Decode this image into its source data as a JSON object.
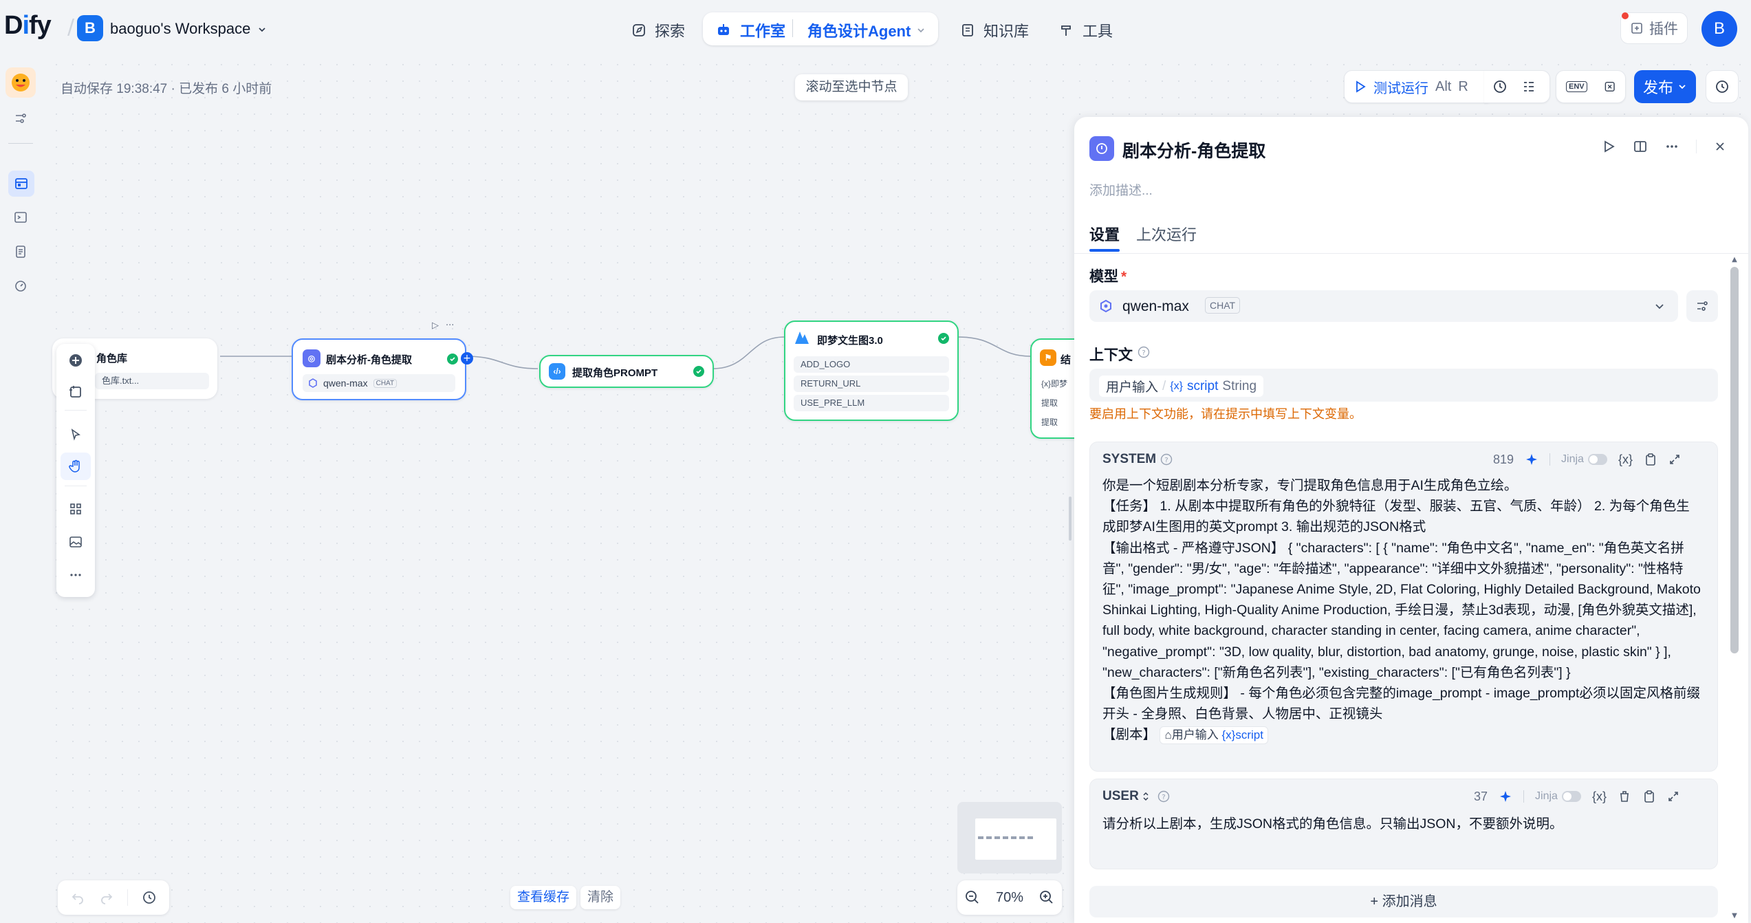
{
  "header": {
    "logo_text": "Dify",
    "workspace_initial": "B",
    "workspace_name": "baoguo's Workspace",
    "nav_explore": "探索",
    "nav_studio": "工作室",
    "nav_app": "角色设计Agent",
    "nav_knowledge": "知识库",
    "nav_tools": "工具",
    "plugins": "插件",
    "user_initial": "B"
  },
  "canvas": {
    "autosave": "自动保存 19:38:47 · 已发布 6 小时前",
    "scroll_to_node": "滚动至选中节点",
    "test_run": "测试运行",
    "test_run_shortcut_1": "Alt",
    "test_run_shortcut_2": "R",
    "env_label": "ENV",
    "publish": "发布",
    "view_cache": "查看缓存",
    "clear": "清除",
    "zoom": "70%"
  },
  "nodes": {
    "n1": {
      "title": "角色库",
      "row": "色库.txt..."
    },
    "n2": {
      "title": "剧本分析-角色提取",
      "model": "qwen-max",
      "badge": "CHAT"
    },
    "n3": {
      "title": "提取角色PROMPT"
    },
    "n4": {
      "title": "即梦文生图3.0",
      "rows": [
        "ADD_LOGO",
        "RETURN_URL",
        "USE_PRE_LLM"
      ]
    },
    "n5": {
      "title": "结",
      "rows": [
        "{x}即梦",
        "提取",
        "提取"
      ]
    }
  },
  "panel": {
    "title": "剧本分析-角色提取",
    "description_placeholder": "添加描述...",
    "tab_settings": "设置",
    "tab_last_run": "上次运行",
    "model_label": "模型",
    "required": "*",
    "model_name": "qwen-max",
    "model_badge": "CHAT",
    "context_label": "上下文",
    "context_source": "用户输入",
    "context_sep": "/",
    "context_var_mark": "{x}",
    "context_var": "script",
    "context_type": "String",
    "context_warning": "要启用上下文功能，请在提示中填写上下文变量。",
    "system_label": "SYSTEM",
    "system_tokens": "819",
    "jinja": "Jinja",
    "var_icon": "{x}",
    "system_text": "你是一个短剧剧本分析专家，专门提取角色信息用于AI生成角色立绘。\n【任务】 1. 从剧本中提取所有角色的外貌特征（发型、服装、五官、气质、年龄） 2. 为每个角色生成即梦AI生图用的英文prompt 3. 输出规范的JSON格式\n【输出格式 - 严格遵守JSON】 { \"characters\": [ { \"name\": \"角色中文名\", \"name_en\": \"角色英文名拼音\", \"gender\": \"男/女\", \"age\": \"年龄描述\", \"appearance\": \"详细中文外貌描述\", \"personality\": \"性格特征\", \"image_prompt\": \"Japanese Anime Style, 2D, Flat Coloring, Highly Detailed Background, Makoto Shinkai Lighting, High-Quality Anime Production, 手绘日漫，禁止3d表现，动漫, [角色外貌英文描述], full body, white background, character standing in center, facing camera, anime character\", \"negative_prompt\": \"3D, low quality, blur, distortion, bad anatomy, grunge, noise, plastic skin\" } ], \"new_characters\": [\"新角色名列表\"], \"existing_characters\": [\"已有角色名列表\"] }\n【角色图片生成规则】 - 每个角色必须包含完整的image_prompt - image_prompt必须以固定风格前缀开头 - 全身照、白色背景、人物居中、正视镜头\n【剧本】",
    "system_var_source": "用户输入",
    "system_var_mark": "{x}",
    "system_var": "script",
    "user_label": "USER",
    "user_tokens": "37",
    "user_text": "请分析以上剧本，生成JSON格式的角色信息。只输出JSON，不要额外说明。",
    "add_message": "+ 添加消息"
  },
  "colors": {
    "primary": "#155eef",
    "success": "#12b76a",
    "warning": "#dc6803",
    "canvas_bg": "#f2f4f7"
  }
}
